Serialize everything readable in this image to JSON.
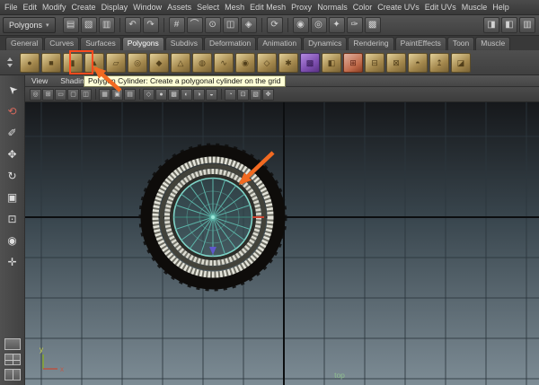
{
  "menubar": {
    "items": [
      "File",
      "Edit",
      "Modify",
      "Create",
      "Display",
      "Window",
      "Assets",
      "Select",
      "Mesh",
      "Edit Mesh",
      "Proxy",
      "Normals",
      "Color",
      "Create UVs",
      "Edit UVs",
      "Muscle",
      "Help"
    ]
  },
  "toolbar": {
    "mode_dropdown": "Polygons",
    "dropdown_caret": "▾",
    "icons": [
      {
        "name": "new-scene",
        "glyph": "▤"
      },
      {
        "name": "open-scene",
        "glyph": "▧"
      },
      {
        "name": "save-scene",
        "glyph": "▥"
      },
      {
        "name": "undo",
        "glyph": "↶"
      },
      {
        "name": "redo",
        "glyph": "↷"
      },
      {
        "name": "snap-to-grids",
        "glyph": "#"
      },
      {
        "name": "snap-to-curves",
        "glyph": "⌒"
      },
      {
        "name": "snap-to-points",
        "glyph": "⊙"
      },
      {
        "name": "snap-to-view-planes",
        "glyph": "◫"
      },
      {
        "name": "make-live",
        "glyph": "◈"
      },
      {
        "name": "construction-history",
        "glyph": "⟳"
      },
      {
        "name": "render-current-frame",
        "glyph": "◉"
      },
      {
        "name": "ipr-render",
        "glyph": "◎"
      },
      {
        "name": "render-settings",
        "glyph": "✦"
      },
      {
        "name": "paint-effects-panel",
        "glyph": "✑"
      },
      {
        "name": "hypershade",
        "glyph": "▩"
      }
    ],
    "right_icons": [
      {
        "name": "attribute-editor-toggle",
        "glyph": "◨"
      },
      {
        "name": "tool-settings-toggle",
        "glyph": "◧"
      },
      {
        "name": "channel-box-toggle",
        "glyph": "▥"
      }
    ]
  },
  "shelf_tabs": {
    "active": "Polygons",
    "items": [
      "General",
      "Curves",
      "Surfaces",
      "Polygons",
      "Subdivs",
      "Deformation",
      "Animation",
      "Dynamics",
      "Rendering",
      "PaintEffects",
      "Toon",
      "Muscle"
    ]
  },
  "shelf": {
    "icons": [
      {
        "name": "polygon-sphere",
        "glyph": "●"
      },
      {
        "name": "polygon-cube",
        "glyph": "■"
      },
      {
        "name": "polygon-cylinder",
        "glyph": "▮"
      },
      {
        "name": "polygon-cone",
        "glyph": "▲"
      },
      {
        "name": "polygon-plane",
        "glyph": "▱"
      },
      {
        "name": "polygon-torus",
        "glyph": "◎"
      },
      {
        "name": "polygon-prism",
        "glyph": "◆"
      },
      {
        "name": "polygon-pyramid",
        "glyph": "△"
      },
      {
        "name": "polygon-pipe",
        "glyph": "◍"
      },
      {
        "name": "polygon-helix",
        "glyph": "∿"
      },
      {
        "name": "polygon-soccer-ball",
        "glyph": "◉"
      },
      {
        "name": "platonic-solid",
        "glyph": "◇"
      },
      {
        "name": "sculpt-geometry-tool",
        "glyph": "✱"
      },
      {
        "name": "smooth",
        "glyph": "▩"
      },
      {
        "name": "mirror-geometry",
        "glyph": "◧"
      },
      {
        "name": "combine",
        "glyph": "⊞"
      },
      {
        "name": "separate",
        "glyph": "⊟"
      },
      {
        "name": "extract",
        "glyph": "⊠"
      },
      {
        "name": "booleans",
        "glyph": "◓"
      },
      {
        "name": "extrude",
        "glyph": "↥"
      },
      {
        "name": "bevel",
        "glyph": "◪"
      }
    ]
  },
  "tooltip": {
    "text": "Polygon Cylinder: Create a polygonal cylinder on the grid"
  },
  "toolbox": {
    "tools": [
      {
        "name": "select-tool",
        "glyph": "➤"
      },
      {
        "name": "lasso-tool",
        "glyph": "⟲"
      },
      {
        "name": "paint-selection-tool",
        "glyph": "✐"
      },
      {
        "name": "move-tool",
        "glyph": "✥"
      },
      {
        "name": "rotate-tool",
        "glyph": "↻"
      },
      {
        "name": "scale-tool",
        "glyph": "▣"
      },
      {
        "name": "universal-manipulator",
        "glyph": "⊡"
      },
      {
        "name": "soft-modification-tool",
        "glyph": "◉"
      },
      {
        "name": "show-manipulator-tool",
        "glyph": "✛"
      }
    ]
  },
  "panel_menu": {
    "items": [
      "View",
      "Shading"
    ]
  },
  "viewport_toolbar": {
    "icons": [
      {
        "name": "select-camera",
        "glyph": "◎"
      },
      {
        "name": "grid-toggle",
        "glyph": "⊞"
      },
      {
        "name": "film-gate",
        "glyph": "▭"
      },
      {
        "name": "resolution-gate",
        "glyph": "▢"
      },
      {
        "name": "gate-mask",
        "glyph": "◫"
      },
      {
        "name": "field-chart",
        "glyph": "▦"
      },
      {
        "name": "safe-action",
        "glyph": "▣"
      },
      {
        "name": "safe-title",
        "glyph": "▤"
      },
      {
        "name": "wireframe-mode",
        "glyph": "◇"
      },
      {
        "name": "smooth-shade-mode",
        "glyph": "●"
      },
      {
        "name": "textured-mode",
        "glyph": "▩"
      },
      {
        "name": "use-default-material",
        "glyph": "◐"
      },
      {
        "name": "lighting-toggle",
        "glyph": "◑"
      },
      {
        "name": "shadows-toggle",
        "glyph": "◒"
      },
      {
        "name": "xray-mode",
        "glyph": "◔"
      },
      {
        "name": "isolate-select",
        "glyph": "⊡"
      },
      {
        "name": "image-plane",
        "glyph": "▧"
      },
      {
        "name": "pan-zoom",
        "glyph": "✥"
      }
    ]
  },
  "viewport": {
    "camera_label": "top",
    "axis_labels": {
      "y": "y",
      "x": "x"
    }
  },
  "annotations": {
    "arrow_color": "#f26a21",
    "highlight_color": "#ff4b1f"
  },
  "colors": {
    "tooltip_bg": "#ffffd6",
    "wireframe_teal": "#63c0b2",
    "selected_edge_white": "#e4e4da",
    "viewport_gradient_top": "#16181b",
    "viewport_gradient_bottom": "#7d8c95"
  }
}
